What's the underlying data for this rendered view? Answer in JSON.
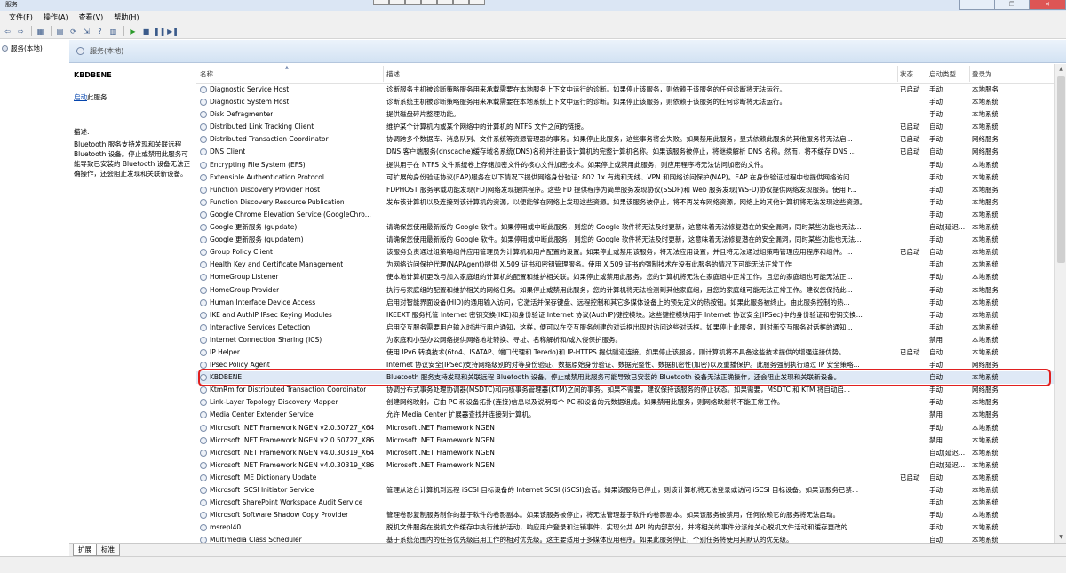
{
  "window": {
    "title": "服务",
    "task_buttons": [
      "",
      "",
      "",
      "",
      "",
      "",
      ""
    ]
  },
  "menu": [
    "文件(F)",
    "操作(A)",
    "查看(V)",
    "帮助(H)"
  ],
  "tree": {
    "root_label": "服务(本地)"
  },
  "panel_header": {
    "title": "服务(本地)"
  },
  "description_panel": {
    "service_name": "KBDBENE",
    "start_link": "启动",
    "start_suffix": "此服务",
    "desc_label": "描述:",
    "desc_text": "Bluetooth 服务支持发现和关联远程 Bluetooth 设备。停止或禁用此服务可能导致已安装的 Bluetooth 设备无法正确操作，还会阻止发现和关联新设备。"
  },
  "columns": {
    "name": "名称",
    "desc": "描述",
    "status": "状态",
    "start": "启动类型",
    "logon": "登录为"
  },
  "rows": [
    {
      "name": "Diagnostic Service Host",
      "desc": "诊断服务主机被诊断策略服务用来承载需要在本地服务上下文中运行的诊断。如果停止该服务，则依赖于该服务的任何诊断将无法运行。",
      "status": "已启动",
      "start": "手动",
      "logon": "本地服务"
    },
    {
      "name": "Diagnostic System Host",
      "desc": "诊断系统主机被诊断策略服务用来承载需要在本地系统上下文中运行的诊断。如果停止该服务，则依赖于该服务的任何诊断将无法运行。",
      "status": "",
      "start": "手动",
      "logon": "本地系统"
    },
    {
      "name": "Disk Defragmenter",
      "desc": "提供磁盘碎片整理功能。",
      "status": "",
      "start": "手动",
      "logon": "本地系统"
    },
    {
      "name": "Distributed Link Tracking Client",
      "desc": "维护某个计算机内或某个网络中的计算机的 NTFS 文件之间的链接。",
      "status": "已启动",
      "start": "自动",
      "logon": "本地系统"
    },
    {
      "name": "Distributed Transaction Coordinator",
      "desc": "协调跨多个数据库、消息队列、文件系统等资源管理器的事务。如果停止此服务，这些事务将会失败。如果禁用此服务，显式依赖此服务的其他服务将无法启...",
      "status": "已启动",
      "start": "手动",
      "logon": "网络服务"
    },
    {
      "name": "DNS Client",
      "desc": "DNS 客户端服务(dnscache)缓存域名系统(DNS)名称并注册该计算机的完整计算机名称。如果该服务被停止，将继续解析 DNS 名称。然而，将不缓存 DNS ...",
      "status": "已启动",
      "start": "自动",
      "logon": "网络服务"
    },
    {
      "name": "Encrypting File System (EFS)",
      "desc": "提供用于在 NTFS 文件系统卷上存储加密文件的核心文件加密技术。如果停止或禁用此服务，则应用程序将无法访问加密的文件。",
      "status": "",
      "start": "手动",
      "logon": "本地系统"
    },
    {
      "name": "Extensible Authentication Protocol",
      "desc": "可扩展的身份验证协议(EAP)服务在以下情况下提供网络身份验证: 802.1x 有线和无线、VPN 和网络访问保护(NAP)。EAP 在身份验证过程中也提供网络访问...",
      "status": "",
      "start": "手动",
      "logon": "本地系统"
    },
    {
      "name": "Function Discovery Provider Host",
      "desc": "FDPHOST 服务承载功能发现(FD)网络发现提供程序。这些 FD 提供程序为简单服务发现协议(SSDP)和 Web 服务发现(WS-D)协议提供网络发现服务。使用 F...",
      "status": "",
      "start": "手动",
      "logon": "本地服务"
    },
    {
      "name": "Function Discovery Resource Publication",
      "desc": "发布该计算机以及连接到该计算机的资源，以便能够在网络上发现这些资源。如果该服务被停止，将不再发布网络资源，网络上的其他计算机将无法发现这些资源。",
      "status": "",
      "start": "手动",
      "logon": "本地服务"
    },
    {
      "name": "Google Chrome Elevation Service (GoogleChro...",
      "desc": "",
      "status": "",
      "start": "手动",
      "logon": "本地系统"
    },
    {
      "name": "Google 更新服务 (gupdate)",
      "desc": "请确保您使用最新版的 Google 软件。如果停用或中断此服务，则您的 Google 软件将无法及时更新，这意味着无法修复潜在的安全漏洞，同时某些功能也无法...",
      "status": "",
      "start": "自动(延迟...",
      "logon": "本地系统"
    },
    {
      "name": "Google 更新服务 (gupdatem)",
      "desc": "请确保您使用最新版的 Google 软件。如果停用或中断此服务，则您的 Google 软件将无法及时更新，这意味着无法修复潜在的安全漏洞，同时某些功能也无法...",
      "status": "",
      "start": "手动",
      "logon": "本地系统"
    },
    {
      "name": "Group Policy Client",
      "desc": "该服务负责通过组策略组件应用管理员为计算机和用户配置的设置。如果停止或禁用该服务，将无法应用设置，并且将无法通过组策略管理应用程序和组件。...",
      "status": "已启动",
      "start": "自动",
      "logon": "本地系统"
    },
    {
      "name": "Health Key and Certificate Management",
      "desc": "为网络访问保护代理(NAPAgent)提供 X.509 证书和密钥管理服务。使用 X.509 证书的强制技术在没有此服务的情况下可能无法正常工作",
      "status": "",
      "start": "手动",
      "logon": "本地系统"
    },
    {
      "name": "HomeGroup Listener",
      "desc": "使本地计算机更改与加入家庭组的计算机的配置和维护相关联。如果停止或禁用此服务，您的计算机将无法在家庭组中正常工作，且您的家庭组也可能无法正...",
      "status": "",
      "start": "手动",
      "logon": "本地系统"
    },
    {
      "name": "HomeGroup Provider",
      "desc": "执行与家庭组的配置和维护相关的网络任务。如果停止或禁用此服务，您的计算机将无法检测到其他家庭组，且您的家庭组可能无法正常工作。建议您保持此...",
      "status": "",
      "start": "手动",
      "logon": "本地服务"
    },
    {
      "name": "Human Interface Device Access",
      "desc": "启用对智能界面设备(HID)的通用输入访问，它激活并保存键盘、远程控制和其它多媒体设备上的预先定义的热按钮。如果此服务被终止，由此服务控制的热...",
      "status": "",
      "start": "手动",
      "logon": "本地系统"
    },
    {
      "name": "IKE and AuthIP IPsec Keying Modules",
      "desc": "IKEEXT 服务托管 Internet 密钥交换(IKE)和身份验证 Internet 协议(AuthIP)键控模块。这些键控模块用于 Internet 协议安全(IPSec)中的身份验证和密钥交换...",
      "status": "",
      "start": "手动",
      "logon": "本地系统"
    },
    {
      "name": "Interactive Services Detection",
      "desc": "启用交互服务需要用户输入时进行用户通知，这样，便可以在交互服务创建的对话框出现时访问这些对话框。如果停止此服务，则对新交互服务对话框的通知...",
      "status": "",
      "start": "手动",
      "logon": "本地系统"
    },
    {
      "name": "Internet Connection Sharing (ICS)",
      "desc": "为家庭和小型办公网络提供网络地址转换、寻址、名称解析和/或入侵保护服务。",
      "status": "",
      "start": "禁用",
      "logon": "本地系统"
    },
    {
      "name": "IP Helper",
      "desc": "使用 IPv6 转换技术(6to4、ISATAP、端口代理和 Teredo)和 IP-HTTPS 提供隧道连接。如果停止该服务，则计算机将不具备这些技术提供的增强连接优势。",
      "status": "已启动",
      "start": "自动",
      "logon": "本地系统"
    },
    {
      "name": "IPsec Policy Agent",
      "desc": "Internet 协议安全(IPSec)支持网络级别的对等身份验证、数据原始身份验证、数据完整性、数据机密性(加密)以及重播保护。此服务强制执行通过 IP 安全策略...",
      "status": "",
      "start": "手动",
      "logon": "网络服务"
    },
    {
      "name": "KBDBENE",
      "desc": "Bluetooth 服务支持发现和关联远程 Bluetooth 设备。停止或禁用此服务可能导致已安装的 Bluetooth 设备无法正确操作，还会阻止发现和关联新设备。",
      "status": "",
      "start": "自动",
      "logon": "本地系统"
    },
    {
      "name": "KtmRm for Distributed Transaction Coordinator",
      "desc": "协调分布式事务处理协调器(MSDTC)和内核事务管理器(KTM)之间的事务。如果不需要，建议保持该服务的停止状态。如果需要，MSDTC 和 KTM 将自动启...",
      "status": "",
      "start": "手动",
      "logon": "网络服务"
    },
    {
      "name": "Link-Layer Topology Discovery Mapper",
      "desc": "创建网络映射，它由 PC 和设备拓扑(连接)信息以及说明每个 PC 和设备的元数据组成。如果禁用此服务，则网络映射将不能正常工作。",
      "status": "",
      "start": "手动",
      "logon": "本地服务"
    },
    {
      "name": "Media Center Extender Service",
      "desc": "允许 Media Center 扩展器查找并连接到计算机。",
      "status": "",
      "start": "禁用",
      "logon": "本地服务"
    },
    {
      "name": "Microsoft .NET Framework NGEN v2.0.50727_X64",
      "desc": "Microsoft .NET Framework NGEN",
      "status": "",
      "start": "手动",
      "logon": "本地系统"
    },
    {
      "name": "Microsoft .NET Framework NGEN v2.0.50727_X86",
      "desc": "Microsoft .NET Framework NGEN",
      "status": "",
      "start": "禁用",
      "logon": "本地系统"
    },
    {
      "name": "Microsoft .NET Framework NGEN v4.0.30319_X64",
      "desc": "Microsoft .NET Framework NGEN",
      "status": "",
      "start": "自动(延迟...",
      "logon": "本地系统"
    },
    {
      "name": "Microsoft .NET Framework NGEN v4.0.30319_X86",
      "desc": "Microsoft .NET Framework NGEN",
      "status": "",
      "start": "自动(延迟...",
      "logon": "本地系统"
    },
    {
      "name": "Microsoft IME Dictionary Update",
      "desc": "",
      "status": "已启动",
      "start": "自动",
      "logon": "本地系统"
    },
    {
      "name": "Microsoft iSCSI Initiator Service",
      "desc": "管理从这台计算机到远程 iSCSI 目标设备的 Internet SCSI (iSCSI)会话。如果该服务已停止，则该计算机将无法登录或访问 iSCSI 目标设备。如果该服务已禁...",
      "status": "",
      "start": "手动",
      "logon": "本地系统"
    },
    {
      "name": "Microsoft SharePoint Workspace Audit Service",
      "desc": "",
      "status": "",
      "start": "手动",
      "logon": "本地系统"
    },
    {
      "name": "Microsoft Software Shadow Copy Provider",
      "desc": "管理卷影复制服务制作的基于软件的卷影副本。如果该服务被停止，将无法管理基于软件的卷影副本。如果该服务被禁用，任何依赖它的服务将无法启动。",
      "status": "",
      "start": "手动",
      "logon": "本地系统"
    },
    {
      "name": "msrepl40",
      "desc": "脱机文件服务在脱机文件缓存中执行维护活动，响应用户登录和注销事件，实现公共 API 的内部部分，并将相关的事件分派给关心脱机文件活动和缓存更改的...",
      "status": "",
      "start": "手动",
      "logon": "本地系统"
    },
    {
      "name": "Multimedia Class Scheduler",
      "desc": "基于系统范围内的任务优先级启用工作的相对优先级。这主要适用于多媒体应用程序。如果此服务停止，个别任务将使用其默认的优先级。",
      "status": "",
      "start": "自动",
      "logon": "本地系统"
    }
  ],
  "tabs": [
    "扩展",
    "标准"
  ]
}
